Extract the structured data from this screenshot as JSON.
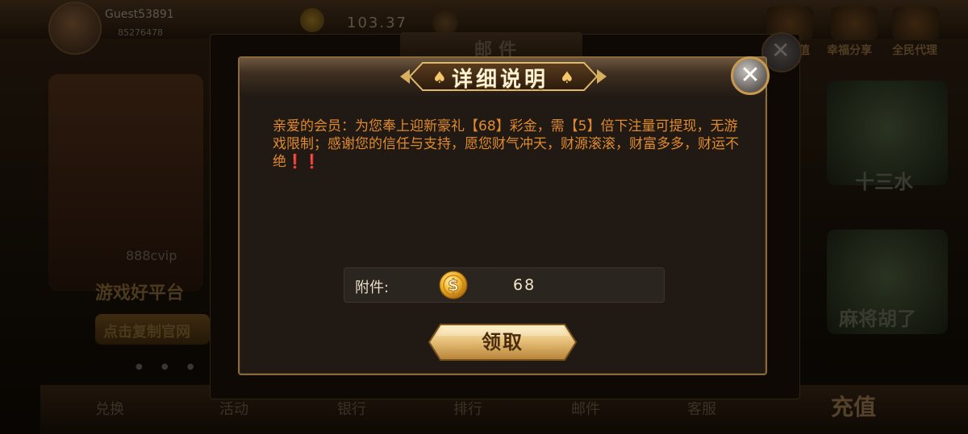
{
  "background": {
    "player": {
      "name": "Guest53891",
      "id": "85276478"
    },
    "balance": "103.37",
    "top_actions": [
      "充值",
      "幸福分享",
      "全民代理"
    ],
    "left_panel": {
      "site": "888cvip",
      "title": "游戏好平台",
      "button": "点击复制官网"
    },
    "right_games": [
      "十三水",
      "麻将胡了"
    ],
    "bottom_nav": [
      "兑换",
      "活动",
      "银行",
      "排行",
      "邮件",
      "客服"
    ],
    "recharge": "充值",
    "outer_dialog_title": "邮件"
  },
  "dialog": {
    "title": "详细说明",
    "message": "亲爱的会员：为您奉上迎新豪礼【68】彩金，需【5】倍下注量可提现，无游戏限制；感谢您的信任与支持，愿您财气冲天，财源滚滚，财富多多，财运不绝❗❗",
    "attachment_label": "附件:",
    "attachment_amount": "68",
    "attachment_icon": "gold-coin-dollar-icon",
    "claim_label": "领取",
    "close_icon": "close-x-icon"
  },
  "colors": {
    "message_text": "#e08a2e",
    "dialog_border": "#8b6a3a",
    "dialog_bg": "#211914",
    "claim_button_gold": "#e8c27a"
  }
}
